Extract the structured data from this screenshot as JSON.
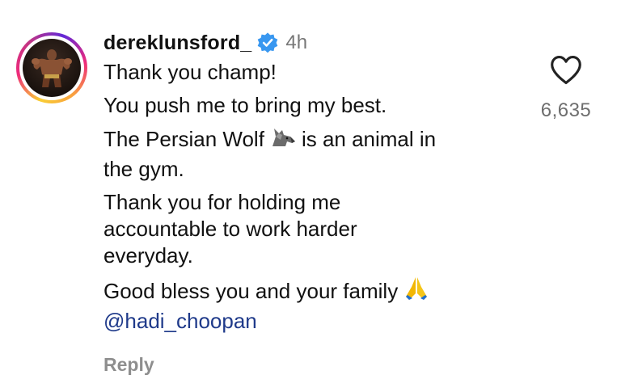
{
  "comment": {
    "username": "dereklunsford_",
    "time": "4h",
    "verified_icon": "verified-badge-icon",
    "lines": {
      "l1": "Thank you champ!",
      "l2": "You push me to bring my best.",
      "l3a": "The Persian Wolf",
      "l3b": "is an animal in",
      "l3c": "the gym.",
      "l4": "Thank you for holding me accountable to work harder everyday.",
      "l5": "Good bless you and your family",
      "mention": "@hadi_choopan"
    },
    "emoji": {
      "wolf": "wolf-emoji-icon",
      "pray": "folded-hands-emoji-icon"
    },
    "reply_label": "Reply",
    "like_count": "6,635",
    "like_icon": "heart-icon"
  },
  "colors": {
    "accent_verified": "#3897f0",
    "muted_text": "#777777",
    "mention": "#1f3a8a"
  }
}
